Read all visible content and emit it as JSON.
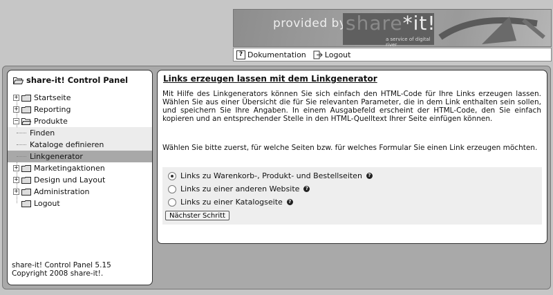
{
  "header": {
    "provided_by": "provided by",
    "logo_share": "share",
    "logo_star": "*",
    "logo_it": "it!",
    "tagline": "a service of digital river",
    "links": [
      {
        "label": "Dokumentation",
        "icon": "help-icon"
      },
      {
        "label": "Logout",
        "icon": "logout-icon"
      }
    ]
  },
  "sidebar": {
    "title": "share-it! Control Panel",
    "items": [
      {
        "label": "Startseite",
        "expander": "+"
      },
      {
        "label": "Reporting",
        "expander": "+"
      },
      {
        "label": "Produkte",
        "expander": "−"
      },
      {
        "label": "Finden"
      },
      {
        "label": "Kataloge definieren"
      },
      {
        "label": "Linkgenerator"
      },
      {
        "label": "Marketingaktionen",
        "expander": "+"
      },
      {
        "label": "Design und Layout",
        "expander": "+"
      },
      {
        "label": "Administration",
        "expander": "+"
      },
      {
        "label": "Logout"
      }
    ],
    "version": "share-it! Control Panel 5.15",
    "copyright": "Copyright 2008 share-it!."
  },
  "main": {
    "title": "Links erzeugen lassen mit dem Linkgenerator",
    "intro": "Mit Hilfe des Linkgenerators können Sie sich einfach den HTML-Code für Ihre Links erzeugen lassen. Wählen Sie aus einer Übersicht die für Sie relevanten Parameter, die in dem Link enthalten sein sollen, und speichern Sie Ihre Angaben. In einem Ausgabefeld erscheint der HTML-Code, den Sie einfach kopieren und an entsprechender Stelle in den HTML-Quelltext Ihrer Seite einfügen können.",
    "instruction": "Wählen Sie bitte zuerst, für welche Seiten bzw. für welches Formular Sie einen Link erzeugen möchten.",
    "options": [
      {
        "label": "Links zu Warenkorb-, Produkt- und Bestellseiten",
        "selected": true
      },
      {
        "label": "Links zu einer anderen Website",
        "selected": false
      },
      {
        "label": "Links zu einer Katalogseite",
        "selected": false
      }
    ],
    "next_button": "Nächster Schritt"
  }
}
